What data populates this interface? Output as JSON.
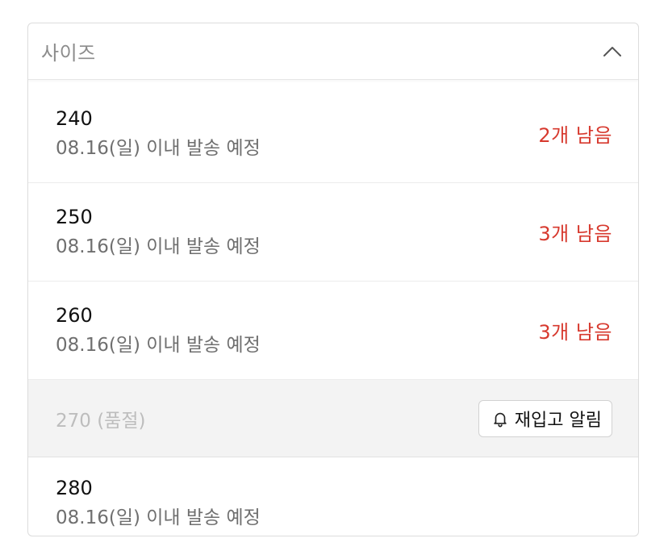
{
  "dropdown": {
    "label": "사이즈",
    "toggle_icon": "chevron-up-icon",
    "options": [
      {
        "size": "240",
        "shipping": "08.16(일) 이내 발송 예정",
        "stock": "2개 남음"
      },
      {
        "size": "250",
        "shipping": "08.16(일) 이내 발송 예정",
        "stock": "3개 남음"
      },
      {
        "size": "260",
        "shipping": "08.16(일) 이내 발송 예정",
        "stock": "3개 남음"
      },
      {
        "size_soldout": "270 (품절)",
        "restock_label": "재입고 알림",
        "restock_icon": "bell-icon"
      },
      {
        "size": "280",
        "shipping": "08.16(일) 이내 발송 예정"
      }
    ]
  },
  "colors": {
    "stock_text": "#d7392e",
    "soldout_bg": "#f3f3f3",
    "soldout_text": "#bdbdbd"
  }
}
